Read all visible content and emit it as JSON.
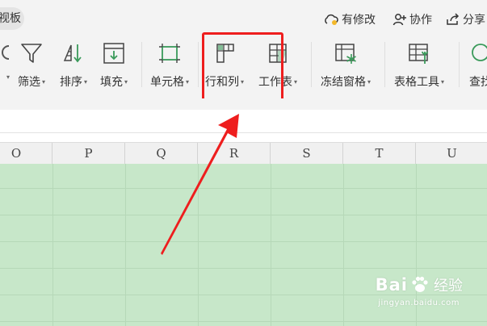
{
  "tab_partial": "视板",
  "top_actions": {
    "modify_label": "有修改",
    "collab_label": "协作",
    "share_label": "分享"
  },
  "toolbar": {
    "partial_left": "‹",
    "filter_label": "筛选",
    "sort_label": "排序",
    "fill_label": "填充",
    "cell_label": "单元格",
    "rowcol_label": "行和列",
    "sheet_label": "工作表",
    "freeze_label": "冻结窗格",
    "tabletools_label": "表格工具",
    "find_label": "查找"
  },
  "columns": [
    "O",
    "P",
    "Q",
    "R",
    "S",
    "T",
    "U"
  ],
  "watermark": {
    "brand_latin": "Bai",
    "brand_cn": "经验",
    "url": "jingyan.baidu.com"
  },
  "colors": {
    "highlight": "#ee1e1e",
    "grid_fill": "#c7e7c9",
    "icon_green": "#3a9a5a"
  }
}
